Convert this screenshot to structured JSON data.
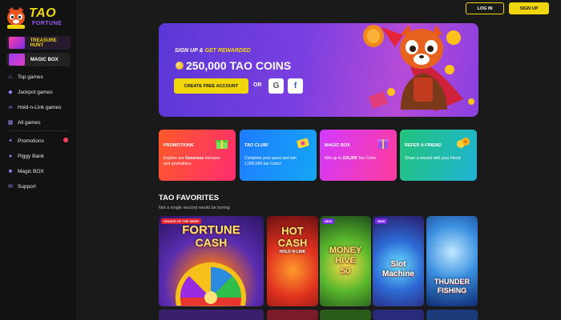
{
  "brand": {
    "name_top": "TAO",
    "name_bottom": "FORTUNE"
  },
  "header": {
    "login_label": "LOG IN",
    "signup_label": "SIGN UP"
  },
  "sidebar": {
    "promo_pills": [
      {
        "label": "TREASURE HUNT"
      },
      {
        "label": "MAGIC BOX"
      }
    ],
    "games": [
      {
        "label": "Top games",
        "icon": "fire-icon"
      },
      {
        "label": "Jackpot games",
        "icon": "diamond-icon"
      },
      {
        "label": "Hold-n-Link games",
        "icon": "link-icon"
      },
      {
        "label": "All games",
        "icon": "grid-icon"
      }
    ],
    "extras": [
      {
        "label": "Promotions",
        "icon": "gift-icon"
      },
      {
        "label": "Piggy Bank",
        "icon": "piggy-bank-icon"
      },
      {
        "label": "Magic BOX",
        "icon": "box-icon"
      },
      {
        "label": "Support",
        "icon": "support-icon"
      }
    ]
  },
  "hero": {
    "sign_up": "SIGN UP",
    "amp": "&",
    "get_rewarded": "GET REWARDED",
    "amount": "250,000 TAO COINS",
    "cta": "CREATE FREE ACCOUNT",
    "or": "OR",
    "google": "G",
    "facebook": "f"
  },
  "cards": [
    {
      "title": "PROMOTIONS",
      "desc_pre": "Explore our ",
      "desc_bold": "Generous",
      "desc_post": " bonuses and promotions"
    },
    {
      "title": "TAO CLUB!",
      "desc": "Complete your quest and win 1,000,000 tao Coins!"
    },
    {
      "title": "MAGIC BOX",
      "desc_pre": "Win up to ",
      "desc_bold": "226,000",
      "desc_post": " Tao Coins"
    },
    {
      "title": "REFER A FRIEND",
      "desc": "Share a reward with your friend"
    }
  ],
  "favorites": {
    "title": "TAO FAVORITES",
    "subtitle": "Not a single second would be boring",
    "tiles": [
      {
        "label_line1": "FORTUNE",
        "label_line2": "CASH",
        "badge": "CHOICE OF THE WEEK"
      },
      {
        "label_line1": "HOT",
        "label_line2": "CASH",
        "label_line3": "HOLD·N·LINK"
      },
      {
        "label_line1": "MONEY",
        "label_line2": "HIVE",
        "label_line3": "50",
        "badge": "NEW"
      },
      {
        "label_line1": "Slot",
        "label_line2": "Machine",
        "badge": "NEW"
      },
      {
        "label_line1": "THUNDER",
        "label_line2": "FISHING"
      }
    ]
  },
  "colors": {
    "accent": "#f2d60c",
    "sidebar_bg": "#121212",
    "page_bg": "#1a1a1a",
    "nav_icon": "#9b86ff"
  }
}
